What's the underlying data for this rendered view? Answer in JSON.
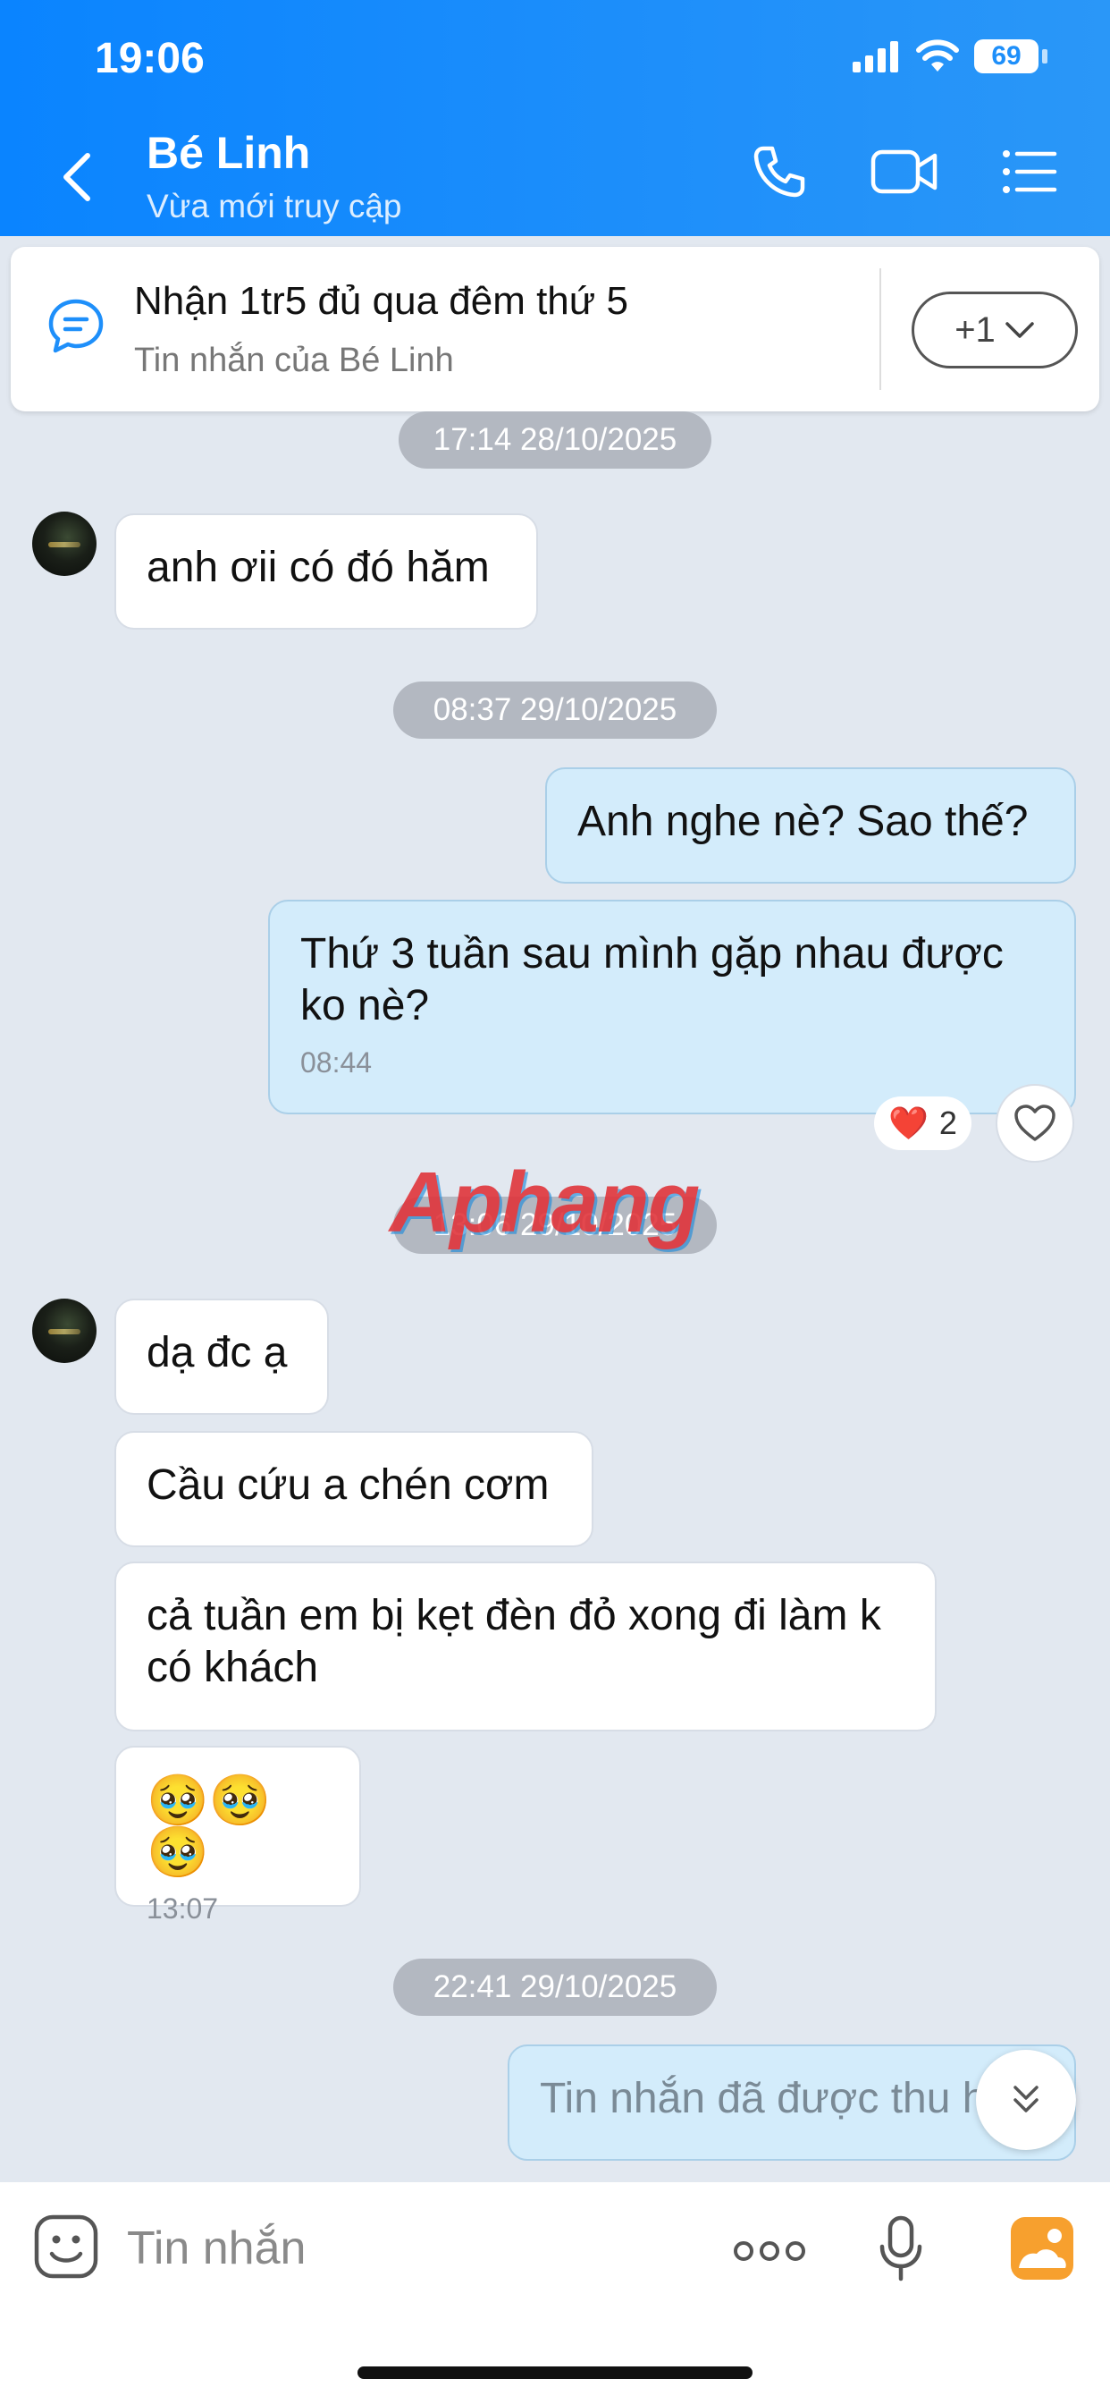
{
  "status_bar": {
    "time": "19:06",
    "battery": "69"
  },
  "header": {
    "contact_name": "Bé Linh",
    "contact_status": "Vừa mới truy cập"
  },
  "pinned": {
    "title": "Nhận 1tr5 đủ qua đêm thứ 5",
    "subtitle": "Tin nhắn của Bé Linh",
    "more_label": "+1"
  },
  "timestamps": [
    "17:14 28/10/2025",
    "08:37 29/10/2025",
    "13:06 29/10/2025",
    "22:41 29/10/2025"
  ],
  "messages": [
    {
      "from": "contact",
      "text": "anh ơii có đó hăm"
    },
    {
      "from": "me",
      "text": "Anh nghe nè? Sao thế?"
    },
    {
      "from": "me",
      "text": "Thứ 3 tuần sau mình gặp nhau được ko nè?",
      "time": "08:44"
    },
    {
      "from": "contact",
      "text": "dạ đc ạ"
    },
    {
      "from": "contact",
      "text": "Cầu cứu a chén cơm"
    },
    {
      "from": "contact",
      "text": "cả tuần em bị kẹt đèn đỏ xong đi làm k có khách"
    },
    {
      "from": "contact",
      "text": "🥹🥹🥹",
      "time": "13:07"
    },
    {
      "from": "me",
      "text": "Tin nhắn đã được thu hồi"
    }
  ],
  "reaction": {
    "emoji": "❤️",
    "count": "2"
  },
  "watermark": "Aphang",
  "input": {
    "placeholder": "Tin nhắn"
  },
  "colors": {
    "header_blue": "#1e8ffa",
    "outgoing_bubble": "#d3ecfb",
    "incoming_bubble": "#ffffff",
    "background": "#e2e8f0"
  }
}
